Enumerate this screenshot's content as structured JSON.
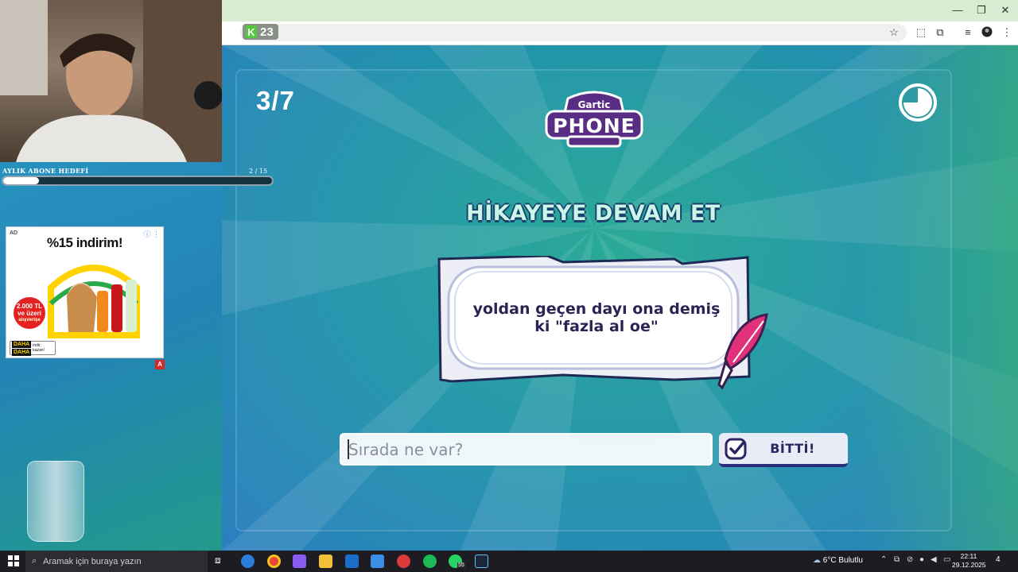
{
  "browser": {
    "extension_badge_letter": "K",
    "extension_badge_count": "23",
    "window_minimize": "—",
    "window_restore": "❐",
    "window_close": "✕"
  },
  "game": {
    "round": "3/7",
    "logo_line1": "Gartic",
    "logo_line2": "PHONE",
    "heading": "HİKAYEYE DEVAM ET",
    "prompt_text": "yoldan geçen dayı ona demiş\nki \"fazla al oe\"",
    "input_placeholder": "Sırada ne var?",
    "input_value": "",
    "done_label": "BİTTİ!",
    "timer_fraction_remaining": 0.75
  },
  "stream_overlay": {
    "goal_label": "AYLIK ABONE HEDEFİ",
    "goal_count": "2 / 15",
    "goal_current": 2,
    "goal_target": 15
  },
  "ad": {
    "tag": "AD",
    "headline": "%15 indirim!",
    "amount_line1": "2.000 TL",
    "amount_line2": "ve üzeri",
    "amount_line3": "alışverişe",
    "brand_line1": "DAHA",
    "brand_line2": "DAHA",
    "brand_slogan1": "indir,",
    "brand_slogan2": "kazan!",
    "badge": "A"
  },
  "taskbar": {
    "search_placeholder": "Aramak için buraya yazın",
    "weather": "6°C  Bulutlu",
    "whatsapp_badge": "55",
    "time": "22:11",
    "date": "29.12.2025",
    "notifications": "4"
  },
  "colors": {
    "heading_fill": "#c8f7ea",
    "heading_outline": "#1d3f6b",
    "logo_purple": "#5a2d84",
    "button_border": "#2b2e7a",
    "quill_pink": "#e0317a"
  }
}
